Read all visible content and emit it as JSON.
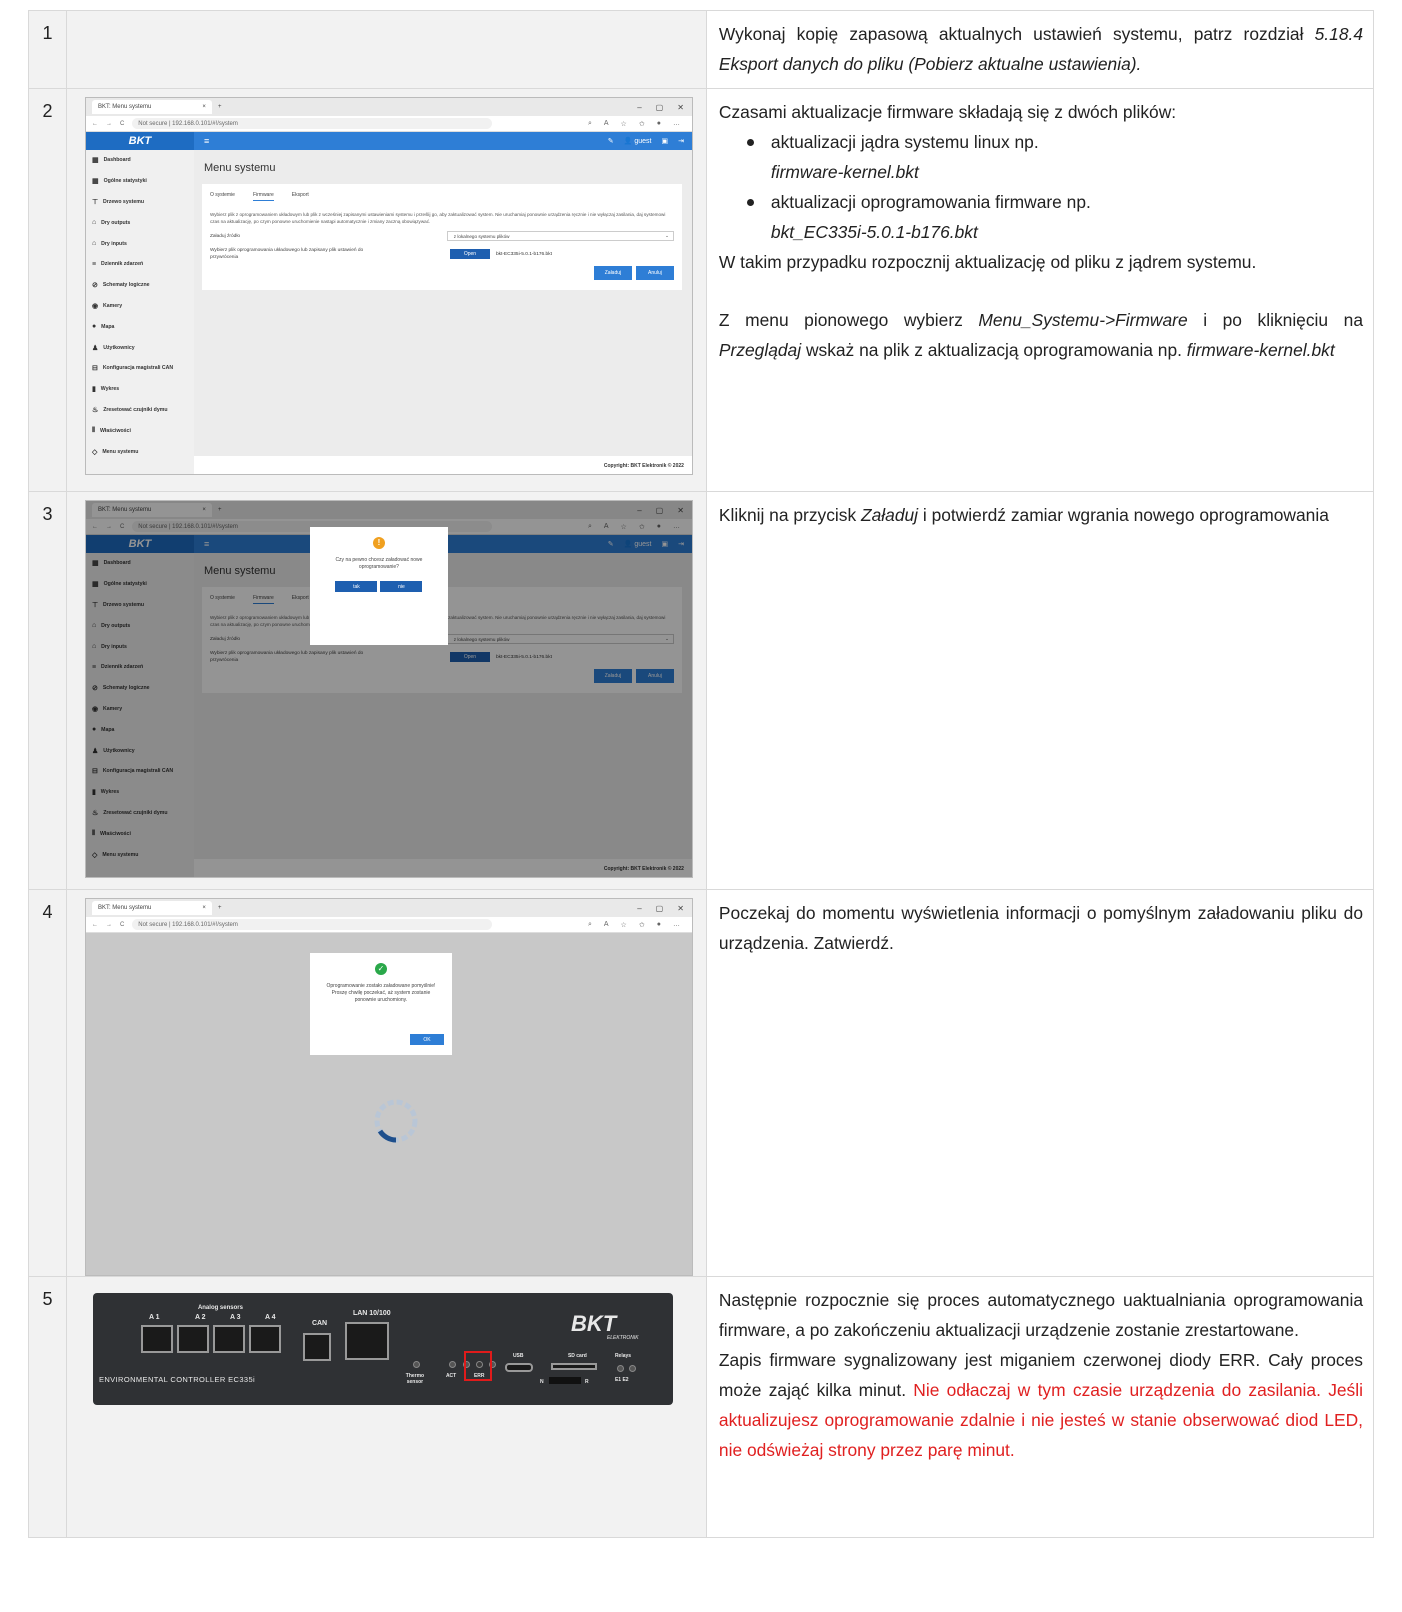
{
  "rows": [
    {
      "num": "1",
      "text": {
        "a": "Wykonaj kopię zapasową aktualnych ustawień systemu, patrz rozdział ",
        "b": "5.18.4 Eksport danych do pliku (Pobierz aktualne ustawienia)."
      }
    },
    {
      "num": "2",
      "text": {
        "intro": "Czasami aktualizacje firmware składają się z dwóch plików:",
        "li1a": "aktualizacji jądra systemu linux np.",
        "li1b": "firmware-kernel.bkt",
        "li2a": "aktualizacji oprogramowania firmware np.",
        "li2b": "bkt_EC335i-5.0.1-b176.bkt",
        "p2": "W takim przypadku rozpocznij aktualizację od pliku z jądrem systemu.",
        "p3a": "Z menu pionowego wybierz ",
        "p3b": "Menu_Systemu->Firmware",
        "p3c": " i po kliknięciu na ",
        "p3d": "Przeglądaj",
        "p3e": " wskaż na plik z aktualizacją oprogramowania np. ",
        "p3f": "firmware-kernel.bkt"
      }
    },
    {
      "num": "3",
      "text": {
        "a": "Kliknij na przycisk ",
        "b": "Załaduj",
        "c": " i potwierdź zamiar wgrania nowego oprogramowania"
      }
    },
    {
      "num": "4",
      "text": {
        "a": "Poczekaj do momentu wyświetlenia informacji o pomyślnym załadowaniu pliku do urządzenia. Zatwierdź."
      }
    },
    {
      "num": "5",
      "text": {
        "p1": "Następnie rozpocznie się proces automatycznego uaktualniania oprogramowania firmware, a po zakończeniu aktualizacji urządzenie zostanie zrestartowane.",
        "p2": "Zapis firmware sygnalizowany jest miganiem czerwonej diody ERR. Cały proces może zająć kilka minut. ",
        "red": "Nie odłaczaj w tym czasie urządzenia do zasilania. Jeśli aktualizujesz oprogramowanie zdalnie i nie jesteś w stanie obserwować diod LED, nie odświeżaj strony przez parę minut."
      }
    }
  ],
  "browser": {
    "tab": "BKT: Menu systemu",
    "url": "Not secure  |  192.168.0.101/#!/system",
    "user": "guest",
    "logo": "BKT"
  },
  "sidebar": [
    "Dashboard",
    "Ogólne statystyki",
    "Drzewo systemu",
    "Dry outputs",
    "Dry inputs",
    "Dziennik zdarzeń",
    "Schematy logiczne",
    "Kamery",
    "Mapa",
    "Użytkownicy",
    "Konfiguracja magistrali CAN",
    "Wykres",
    "Zresetować czujniki dymu",
    "Właściwości",
    "Menu systemu"
  ],
  "page": {
    "title": "Menu systemu",
    "tabs": [
      "O systemie",
      "Firmware",
      "Eksport"
    ],
    "desc": "Wybierz plik z oprogramowaniem układowym lub plik z wcześniej zapisanymi ustawieniami systemu i prześlij go, aby zaktualizować system. Nie uruchamiaj ponownie urządzenia ręcznie i nie wyłączaj zasilania, daj systemowi czas na aktualizację, po czym ponowne uruchomienie nastąpi automatycznie i zmiany zaczną obowiązywać.",
    "src_label": "Załaduj źródło",
    "src_value": "z lokalnego systemu plików",
    "file_label": "Wybierz plik oprogramowania układowego lub zapisany plik ustawień do przywrócenia",
    "open": "Open",
    "file": "bkt-EC335i-5.0.1-b176.bkt",
    "load": "Załaduj",
    "cancel": "Anuluj",
    "footer": "Copyright: BKT Elektronik © 2022"
  },
  "confirm": {
    "text": "Czy na pewno chcesz załadować nowe oprogramowanie?",
    "yes": "tak",
    "no": "nie"
  },
  "success": {
    "text": "Oprogramowanie zostało załadowane pomyślnie! Proszę chwilę poczekać, aż system zostanie ponownie uruchomiony.",
    "ok": "OK"
  },
  "device": {
    "analog": "Analog sensors",
    "a1": "A 1",
    "a2": "A 2",
    "a3": "A 3",
    "a4": "A 4",
    "can": "CAN",
    "lan": "LAN 10/100",
    "name": "ENVIRONMENTAL CONTROLLER EC335i",
    "thermo": "Thermo sensor",
    "act": "ACT",
    "err": "ERR",
    "usb": "USB",
    "sd": "SD card",
    "relays": "Relays",
    "n": "N",
    "r": "R",
    "e": "E1  E2",
    "logo": "BKT",
    "logo_sub": "ELEKTRONIK"
  }
}
